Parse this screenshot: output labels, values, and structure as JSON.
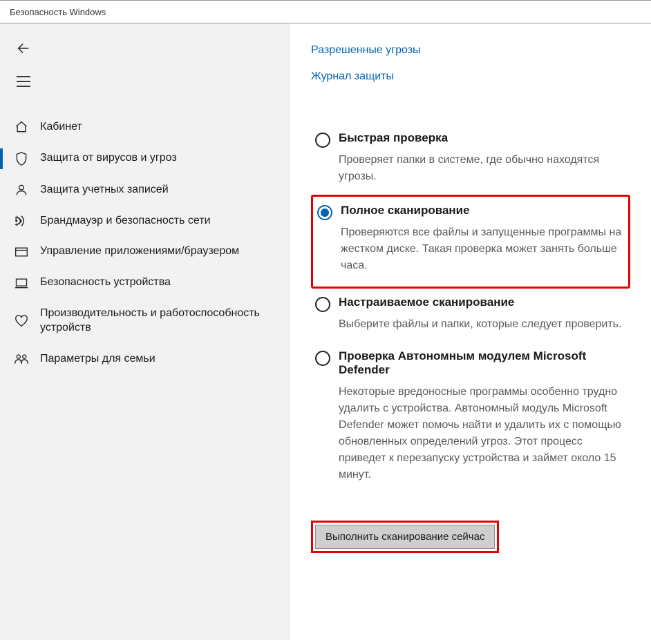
{
  "window": {
    "title": "Безопасность Windows"
  },
  "sidebar": {
    "items": [
      {
        "label": "Кабинет"
      },
      {
        "label": "Защита от вирусов и угроз"
      },
      {
        "label": "Защита учетных записей"
      },
      {
        "label": "Брандмауэр и безопасность сети"
      },
      {
        "label": "Управление приложениями/браузером"
      },
      {
        "label": "Безопасность устройства"
      },
      {
        "label": "Производительность и работоспособность устройств"
      },
      {
        "label": "Параметры для семьи"
      }
    ]
  },
  "links": {
    "allowed_threats": "Разрешенные угрозы",
    "protection_history": "Журнал защиты"
  },
  "scan": {
    "options": [
      {
        "title": "Быстрая проверка",
        "desc": "Проверяет папки в системе, где обычно находятся угрозы."
      },
      {
        "title": "Полное сканирование",
        "desc": "Проверяются все файлы и запущенные программы на жестком диске. Такая проверка может занять больше часа."
      },
      {
        "title": "Настраиваемое сканирование",
        "desc": "Выберите файлы и папки, которые следует проверить."
      },
      {
        "title": "Проверка Автономным модулем Microsoft Defender",
        "desc": "Некоторые вредоносные программы особенно трудно удалить с устройства. Автономный модуль Microsoft Defender может помочь найти и удалить их с помощью обновленных определений угроз. Этот процесс приведет к перезапуску устройства и займет около 15 минут."
      }
    ],
    "button": "Выполнить сканирование сейчас"
  }
}
